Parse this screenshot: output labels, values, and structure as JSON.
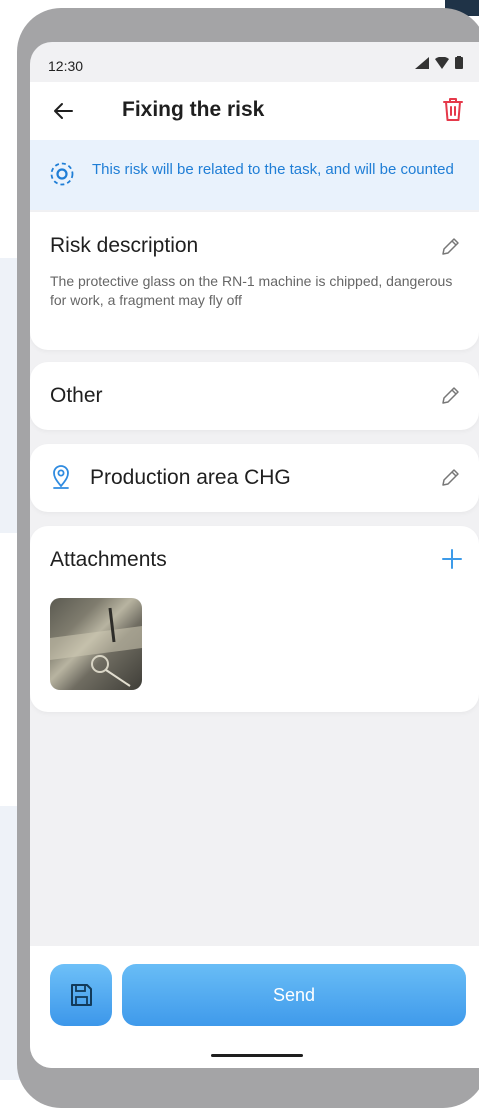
{
  "status_bar": {
    "time": "12:30"
  },
  "header": {
    "title": "Fixing the risk"
  },
  "banner": {
    "text": "This risk will be related to the task, and will be counted"
  },
  "risk_description": {
    "heading": "Risk description",
    "text": "The protective glass on the RN-1 machine is chipped, dangerous for work, a fragment may fly off"
  },
  "category": {
    "label": "Other"
  },
  "location": {
    "label": "Production area CHG"
  },
  "attachments": {
    "heading": "Attachments"
  },
  "actions": {
    "send_label": "Send"
  },
  "colors": {
    "accent": "#3d9be9",
    "delete": "#e5394a",
    "banner_bg": "#e9f2fc"
  },
  "icons": [
    "back-arrow-icon",
    "trash-icon",
    "risk-target-icon",
    "pencil-icon",
    "location-pin-icon",
    "plus-icon",
    "floppy-disk-icon"
  ]
}
